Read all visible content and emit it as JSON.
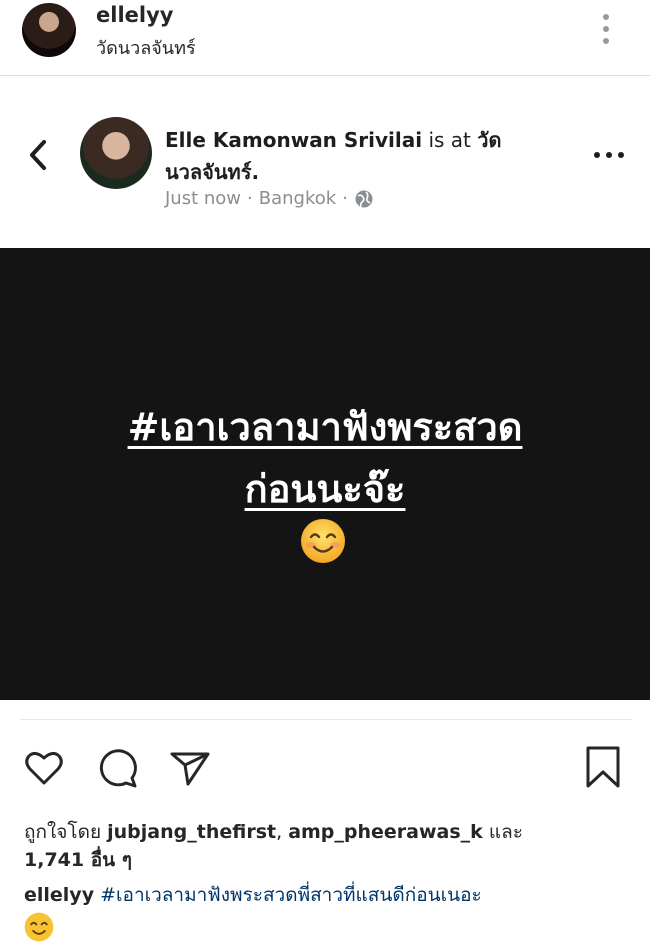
{
  "header": {
    "username": "ellelyy",
    "location": "วัดนวลจันทร์"
  },
  "fb_post": {
    "author_name": "Elle Kamonwan Srivilai",
    "is_at_text": " is at ",
    "place_line1": "วัด",
    "place_line2": "นวลจันทร์.",
    "time": "Just now",
    "sep1": "·",
    "city": "Bangkok",
    "sep2": "·",
    "globe_icon": "globe-icon"
  },
  "post": {
    "text_line1": "#เอาเวลามาฟังพระสวด",
    "text_line2": "ก่อนนะจ๊ะ",
    "emoji": "smiling-face-emoji",
    "background": "#141414"
  },
  "actions": {
    "like_icon": "heart-icon",
    "comment_icon": "comment-icon",
    "share_icon": "paper-plane-icon",
    "save_icon": "bookmark-icon"
  },
  "likes": {
    "prefix": "ถูกใจโดย ",
    "user1": "jubjang_thefirst",
    "comma": ", ",
    "user2": "amp_pheerawas_k",
    "and": " และ",
    "count": "1,741 อื่น ๆ"
  },
  "caption": {
    "username": "ellelyy",
    "text": " #เอาเวลามาฟังพระสวดพี่สาวที่แสนดีก่อนเนอะ",
    "emoji": "smiling-face-emoji"
  }
}
